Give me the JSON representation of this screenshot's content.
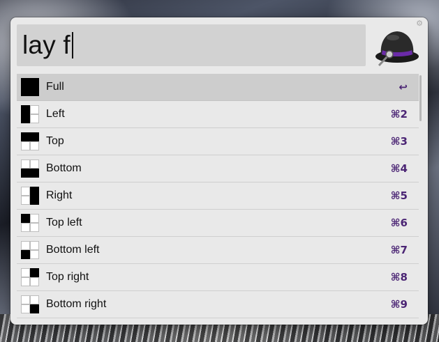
{
  "search": {
    "query": "lay f"
  },
  "results": [
    {
      "label": "Full",
      "shortcut": "↩",
      "cells": [
        1,
        1,
        1,
        1
      ]
    },
    {
      "label": "Left",
      "shortcut": "⌘2",
      "cells": [
        1,
        0,
        1,
        0
      ]
    },
    {
      "label": "Top",
      "shortcut": "⌘3",
      "cells": [
        1,
        1,
        0,
        0
      ]
    },
    {
      "label": "Bottom",
      "shortcut": "⌘4",
      "cells": [
        0,
        0,
        1,
        1
      ]
    },
    {
      "label": "Right",
      "shortcut": "⌘5",
      "cells": [
        0,
        1,
        0,
        1
      ]
    },
    {
      "label": "Top left",
      "shortcut": "⌘6",
      "cells": [
        1,
        0,
        0,
        0
      ]
    },
    {
      "label": "Bottom left",
      "shortcut": "⌘7",
      "cells": [
        0,
        0,
        1,
        0
      ]
    },
    {
      "label": "Top right",
      "shortcut": "⌘8",
      "cells": [
        0,
        1,
        0,
        0
      ]
    },
    {
      "label": "Bottom right",
      "shortcut": "⌘9",
      "cells": [
        0,
        0,
        0,
        1
      ]
    }
  ],
  "selected_index": 0,
  "icons": {
    "app": "alfred-hat-icon",
    "settings": "gear-icon"
  },
  "colors": {
    "shortcut": "#4b2574",
    "selected_row": "#cdcdcd",
    "background": "#e9e9e9"
  }
}
